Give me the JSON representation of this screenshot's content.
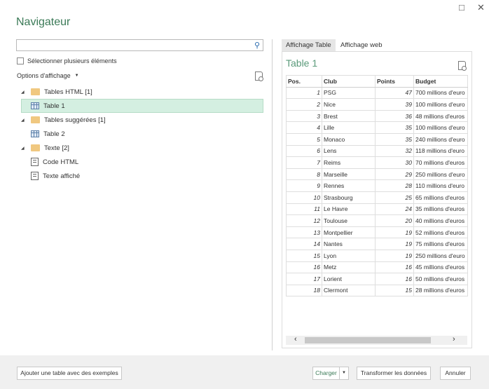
{
  "window": {
    "maximize_icon": "□",
    "close_icon": "✕"
  },
  "title": "Navigateur",
  "search": {
    "value": "",
    "placeholder": "",
    "icon": "⚲"
  },
  "select_multiple": "Sélectionner plusieurs éléments",
  "display_options": "Options d'affichage",
  "tree": [
    {
      "label": "Tables HTML [1]",
      "type": "folder"
    },
    {
      "label": "Table 1",
      "type": "table",
      "selected": true
    },
    {
      "label": "Tables suggérées [1]",
      "type": "folder"
    },
    {
      "label": "Table 2",
      "type": "table"
    },
    {
      "label": "Texte [2]",
      "type": "folder"
    },
    {
      "label": "Code HTML",
      "type": "text"
    },
    {
      "label": "Texte affiché",
      "type": "text"
    }
  ],
  "tabs": [
    "Affichage Table",
    "Affichage web"
  ],
  "preview": {
    "title": "Table 1",
    "columns": [
      "Pos.",
      "Club",
      "Points",
      "Budget"
    ],
    "rows": [
      [
        "1",
        "PSG",
        "47",
        "700 millions d'euro"
      ],
      [
        "2",
        "Nice",
        "39",
        "100 millions d'euro"
      ],
      [
        "3",
        "Brest",
        "36",
        "48 millions d'euros"
      ],
      [
        "4",
        "Lille",
        "35",
        "100 millions d'euro"
      ],
      [
        "5",
        "Monaco",
        "35",
        "240 millions d'euro"
      ],
      [
        "6",
        "Lens",
        "32",
        "118 millions d'euro"
      ],
      [
        "7",
        "Reims",
        "30",
        "70 millions d'euros"
      ],
      [
        "8",
        "Marseille",
        "29",
        "250 millions d'euro"
      ],
      [
        "9",
        "Rennes",
        "28",
        "110 millions d'euro"
      ],
      [
        "10",
        "Strasbourg",
        "25",
        "65 millions d'euros"
      ],
      [
        "11",
        "Le Havre",
        "24",
        "35 millions d'euros"
      ],
      [
        "12",
        "Toulouse",
        "20",
        "40 millions d'euros"
      ],
      [
        "13",
        "Montpellier",
        "19",
        "52 millions d'euros"
      ],
      [
        "14",
        "Nantes",
        "19",
        "75 millions d'euros"
      ],
      [
        "15",
        "Lyon",
        "19",
        "250 millions d'euro"
      ],
      [
        "16",
        "Metz",
        "16",
        "45 millions d'euros"
      ],
      [
        "17",
        "Lorient",
        "16",
        "50 millions d'euros"
      ],
      [
        "18",
        "Clermont",
        "15",
        "28 millions d'euros"
      ]
    ]
  },
  "footer": {
    "add_table": "Ajouter une table avec des exemples",
    "load": "Charger",
    "transform": "Transformer les données",
    "cancel": "Annuler"
  },
  "colors": {
    "accent": "#3b7a57",
    "selection": "#d4efe1"
  }
}
